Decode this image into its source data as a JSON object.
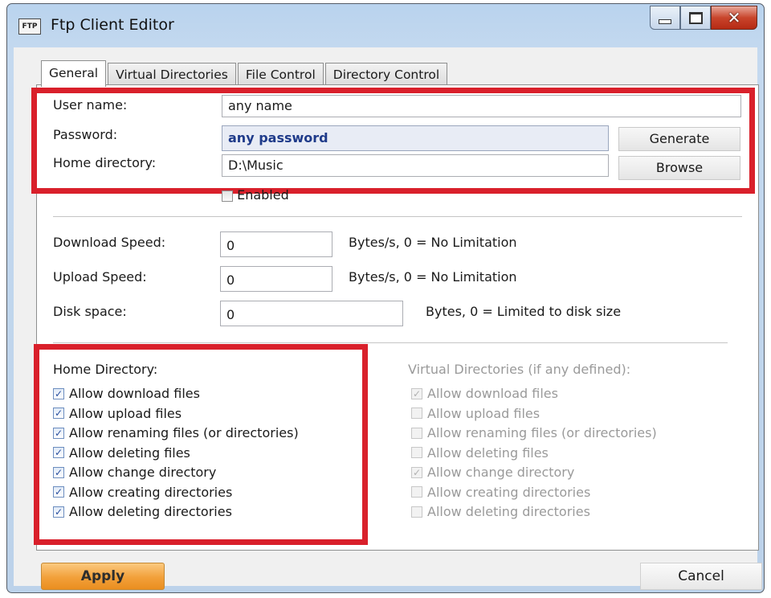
{
  "window": {
    "icon_text": "FTP",
    "title": "Ftp Client Editor",
    "controls": {
      "minimize": "minimize-icon",
      "maximize": "maximize-icon",
      "close": "close-icon",
      "close_glyph": "✕"
    }
  },
  "tabs": [
    {
      "label": "General",
      "active": true
    },
    {
      "label": "Virtual Directories",
      "active": false
    },
    {
      "label": "File Control",
      "active": false
    },
    {
      "label": "Directory Control",
      "active": false
    }
  ],
  "general": {
    "user_name_label": "User name:",
    "user_name_value": "any name",
    "password_label": "Password:",
    "password_value": "any password",
    "generate_label": "Generate",
    "home_dir_label": "Home directory:",
    "home_dir_value": "D:\\Music",
    "browse_label": "Browse",
    "enabled_label": "Enabled",
    "enabled_checked": false
  },
  "limits": {
    "download_label": "Download Speed:",
    "download_value": "0",
    "download_hint": "Bytes/s, 0 = No Limitation",
    "upload_label": "Upload Speed:",
    "upload_value": "0",
    "upload_hint": "Bytes/s, 0 = No Limitation",
    "disk_label": "Disk space:",
    "disk_value": "0",
    "disk_hint": "Bytes, 0 = Limited to disk size"
  },
  "home_permissions": {
    "heading": "Home Directory:",
    "items": [
      {
        "label": "Allow download files",
        "checked": true
      },
      {
        "label": "Allow upload files",
        "checked": true
      },
      {
        "label": "Allow renaming files (or directories)",
        "checked": true
      },
      {
        "label": "Allow deleting files",
        "checked": true
      },
      {
        "label": "Allow change directory",
        "checked": true
      },
      {
        "label": "Allow creating directories",
        "checked": true
      },
      {
        "label": "Allow deleting directories",
        "checked": true
      }
    ]
  },
  "virtual_permissions": {
    "heading": "Virtual Directories (if any defined):",
    "items": [
      {
        "label": "Allow download files",
        "checked": true
      },
      {
        "label": "Allow upload files",
        "checked": false
      },
      {
        "label": "Allow renaming files (or directories)",
        "checked": false
      },
      {
        "label": "Allow deleting files",
        "checked": false
      },
      {
        "label": "Allow change directory",
        "checked": true
      },
      {
        "label": "Allow creating directories",
        "checked": false
      },
      {
        "label": "Allow deleting directories",
        "checked": false
      }
    ]
  },
  "footer": {
    "apply_label": "Apply",
    "cancel_label": "Cancel"
  },
  "colors": {
    "highlight_box": "#d9202b",
    "apply_button": "#f2a03a"
  }
}
